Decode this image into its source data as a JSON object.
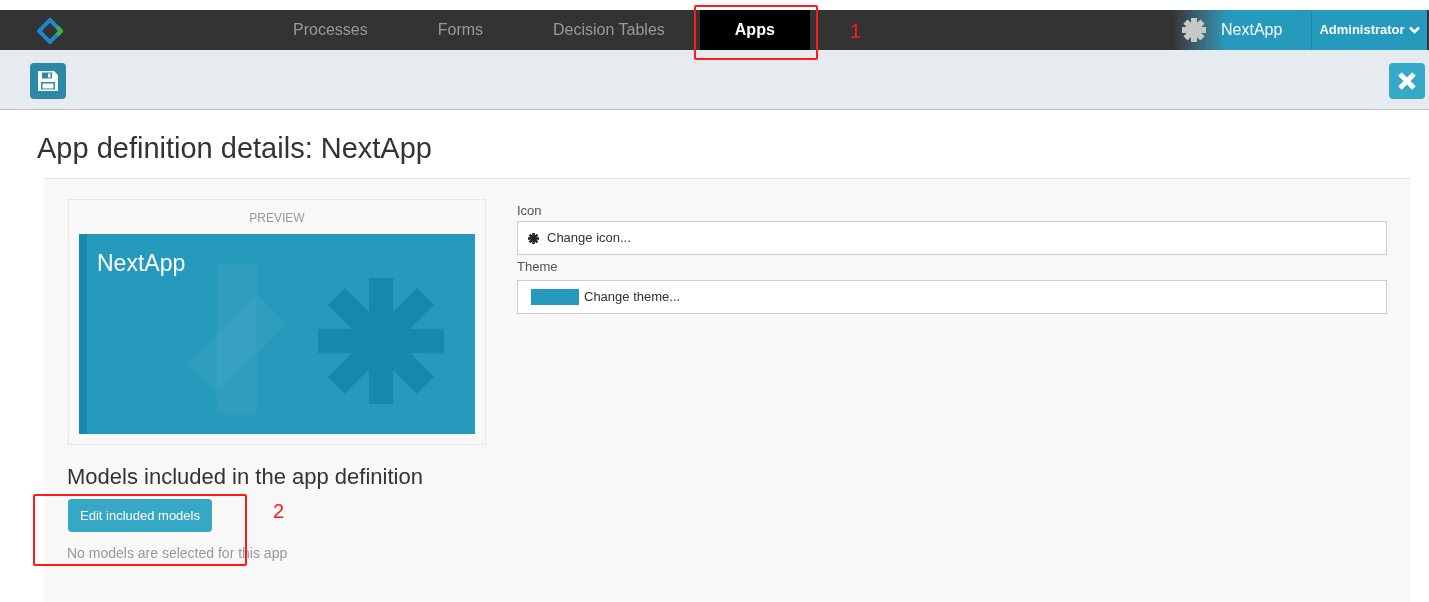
{
  "navbar": {
    "tabs": [
      {
        "label": "Processes",
        "selected": false
      },
      {
        "label": "Forms",
        "selected": false
      },
      {
        "label": "Decision Tables",
        "selected": false
      },
      {
        "label": "Apps",
        "selected": true
      }
    ],
    "app_name": "NextApp",
    "user_menu": "Administrator"
  },
  "page_title": "App definition details: NextApp",
  "preview": {
    "heading": "PREVIEW",
    "app_name": "NextApp",
    "color": "#269abc"
  },
  "icon_field": {
    "label": "Icon",
    "value": "Change icon..."
  },
  "theme_field": {
    "label": "Theme",
    "value": "Change theme...",
    "color": "#269abc"
  },
  "models": {
    "heading": "Models included in the app definition",
    "button": "Edit included models",
    "empty_text": "No models are selected for this app"
  },
  "annotations": [
    {
      "label": "1",
      "kind": "tab"
    },
    {
      "label": "2",
      "kind": "button"
    }
  ]
}
